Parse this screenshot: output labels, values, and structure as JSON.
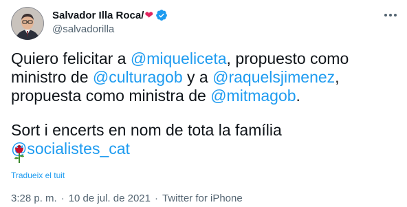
{
  "author": {
    "display_name": "Salvador Illa Roca/",
    "heart": "❤",
    "handle": "@salvadorilla",
    "verified_icon": "verified-badge-icon",
    "colors": {
      "verified": "#1d9bf0",
      "heart": "#e0245e"
    }
  },
  "tweet": {
    "line1_prefix": "Quiero felicitar a ",
    "mention1": "@miqueliceta",
    "line1_suffix": ", propuesto como",
    "line2_prefix": "ministro de ",
    "mention2": "@culturagob",
    "line2_mid": " y a ",
    "mention3": "@raquelsjimenez",
    "line2_suffix": ",",
    "line3_prefix": "propuesta como ministra de ",
    "mention4": "@mitmagob",
    "line3_suffix": ".",
    "line4_prefix": "Sort i encerts en nom de tota la família ",
    "mention5": "@socialistes_cat",
    "emoji_icon": "rose-icon",
    "colors": {
      "mention": "#1d9bf0",
      "text": "#0f1419"
    }
  },
  "translate_link": "Tradueix el tuit",
  "meta": {
    "time": "3:28 p. m.",
    "separator": "·",
    "date": "10 de jul. de 2021",
    "source": "Twitter for iPhone"
  }
}
